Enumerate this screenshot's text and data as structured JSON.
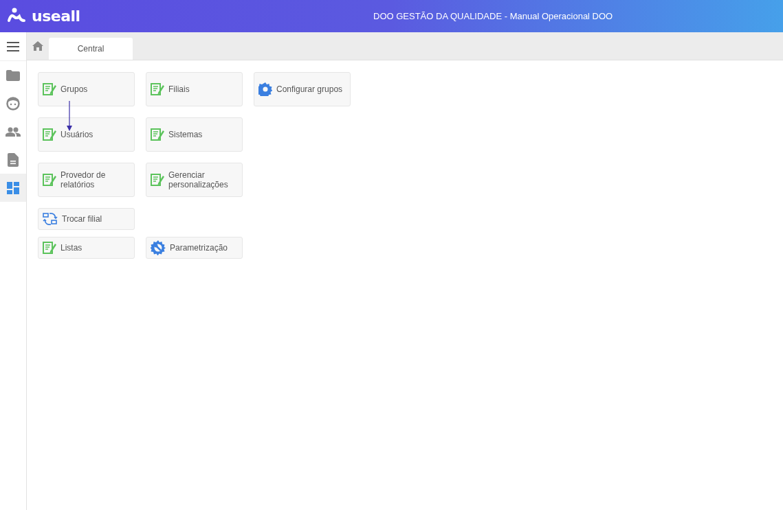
{
  "header": {
    "logo": "useall",
    "title": "DOO GESTÃO DA QUALIDADE - Manual Operacional DOO"
  },
  "sidebar": {
    "items": [
      {
        "kind": "folder",
        "selected": false
      },
      {
        "kind": "face",
        "selected": false
      },
      {
        "kind": "people",
        "selected": false
      },
      {
        "kind": "document",
        "selected": false
      },
      {
        "kind": "dashboard",
        "selected": true
      }
    ]
  },
  "tabs": [
    {
      "label": "Central",
      "selected": true
    }
  ],
  "tile_rows": [
    {
      "tiles": [
        {
          "kind": "form",
          "label": "Grupos"
        },
        {
          "kind": "form",
          "label": "Filiais"
        },
        {
          "kind": "gear",
          "label": "Configurar grupos"
        }
      ]
    },
    {
      "tiles": [
        {
          "kind": "form",
          "label": "Usuários"
        },
        {
          "kind": "form",
          "label": "Sistemas"
        }
      ]
    },
    {
      "tiles": [
        {
          "kind": "form",
          "label": "Provedor de relatórios"
        },
        {
          "kind": "form",
          "label": "Gerenciar personalizações"
        }
      ]
    },
    {
      "tiles": [
        {
          "kind": "swap",
          "label": "Trocar filial"
        }
      ],
      "short": true
    },
    {
      "tiles": [
        {
          "kind": "form",
          "label": "Listas"
        },
        {
          "kind": "tool",
          "label": "Parametrização"
        }
      ],
      "short": true
    }
  ],
  "annotation": {
    "kind": "arrow"
  }
}
